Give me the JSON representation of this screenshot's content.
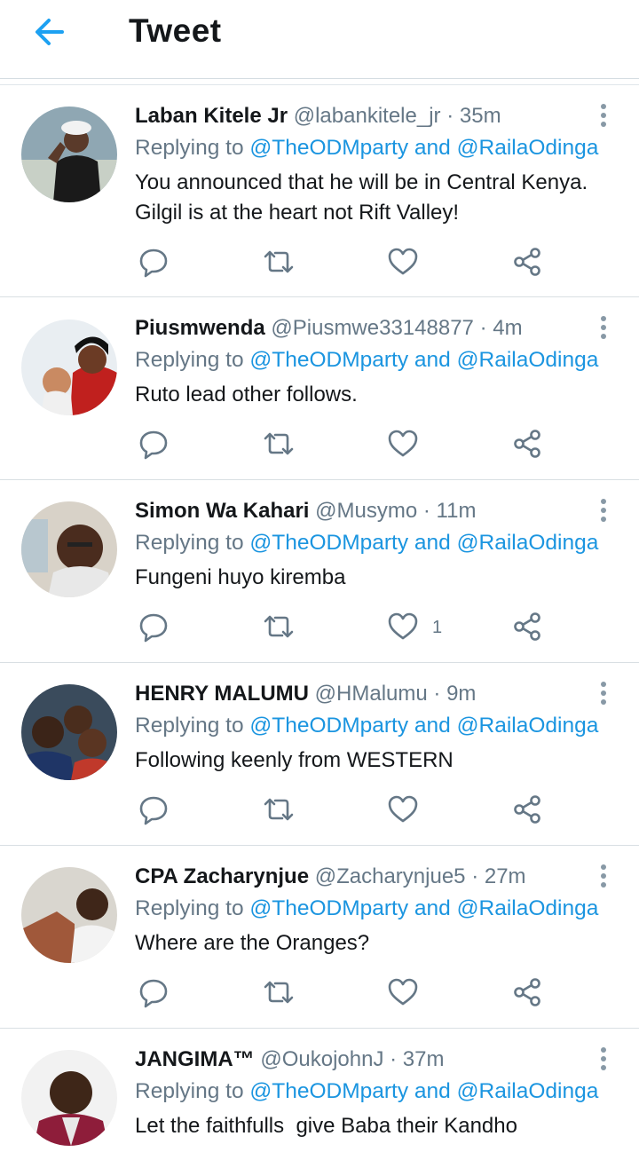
{
  "header": {
    "title": "Tweet",
    "back_icon": "arrow-left-icon",
    "accent": "#1da1f2"
  },
  "reply_prefix": "Replying to",
  "reply_and": "and",
  "tweets": [
    {
      "name": "Laban Kitele Jr",
      "handle": "@labankitele_jr",
      "dot": "·",
      "time": "35m",
      "mention1": "@TheODMparty",
      "mention2": "@RailaOdinga",
      "text": "You announced that he will be in Central Kenya. Gilgil is at the heart not Rift Valley!",
      "likes": ""
    },
    {
      "name": "Piusmwenda",
      "handle": "@Piusmwe33148877",
      "dot": "·",
      "time": "4m",
      "mention1": "@TheODMparty",
      "mention2": "@RailaOdinga",
      "text": "Ruto lead other follows.",
      "likes": ""
    },
    {
      "name": "Simon Wa Kahari",
      "handle": "@Musymo",
      "dot": "·",
      "time": "11m",
      "mention1": "@TheODMparty",
      "mention2": "@RailaOdinga",
      "text": "Fungeni huyo kiremba",
      "likes": "1"
    },
    {
      "name": "HENRY MALUMU",
      "handle": "@HMalumu",
      "dot": "·",
      "time": "9m",
      "mention1": "@TheODMparty",
      "mention2": "@RailaOdinga",
      "text": "Following keenly from WESTERN",
      "likes": ""
    },
    {
      "name": "CPA Zacharynjue",
      "handle": "@Zacharynjue5",
      "dot": "·",
      "time": "27m",
      "mention1": "@TheODMparty",
      "mention2": "@RailaOdinga",
      "text": "Where are the Oranges?",
      "likes": ""
    },
    {
      "name": "JANGIMA™",
      "handle": "@OukojohnJ",
      "dot": "·",
      "time": "37m",
      "mention1": "@TheODMparty",
      "mention2": "@RailaOdinga",
      "text": "Let the faithfulls  give Baba their Kandho",
      "likes": ""
    }
  ],
  "icons": [
    "reply-icon",
    "retweet-icon",
    "like-icon",
    "share-icon",
    "more-icon"
  ],
  "colors": {
    "mention": "#1b95e0",
    "secondary": "#657786"
  }
}
